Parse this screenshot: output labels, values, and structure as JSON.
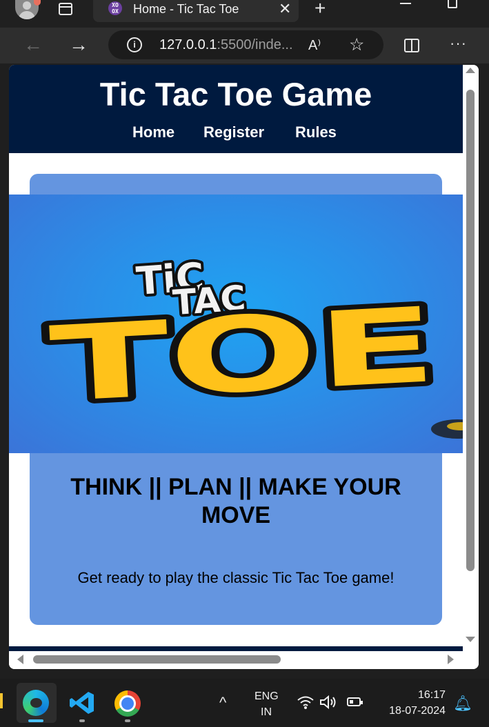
{
  "browser": {
    "tab": {
      "title": "Home - Tic Tac Toe",
      "favicon": "XO\nOX",
      "close_icon": "✕"
    },
    "new_tab_icon": "+",
    "window_controls": {
      "minimize": "minimize-icon",
      "maximize": "maximize-icon"
    },
    "nav": {
      "back": "←",
      "forward": "→"
    },
    "address": {
      "host": "127.0.0.1",
      "rest": ":5500/inde..."
    },
    "toolbar_icons": {
      "read_aloud": "A⁾",
      "favorite": "☆",
      "more": "···"
    }
  },
  "page": {
    "site_title": "Tic Tac Toe Game",
    "nav_links": [
      "Home",
      "Register",
      "Rules"
    ],
    "hero_logo": {
      "line1": "TiC",
      "line2": "TAC",
      "line3": "TOE"
    },
    "tagline": "THINK || PLAN || MAKE YOUR MOVE",
    "description": "Get ready to play the classic Tic Tac Toe game!"
  },
  "colors": {
    "header_bg": "#001a3f",
    "card_bg": "#6495e0",
    "logo_yellow": "#ffc21a"
  },
  "taskbar": {
    "language": {
      "line1": "ENG",
      "line2": "IN"
    },
    "time": "16:17",
    "date": "18-07-2024",
    "chevron": "^",
    "sys_icons": "wifi-icon volume-icon battery-icon"
  }
}
